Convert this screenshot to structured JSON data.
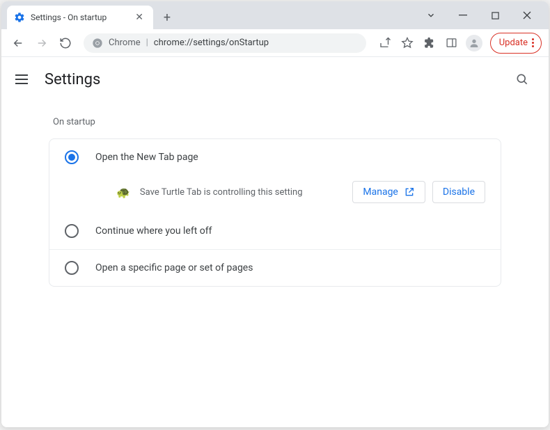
{
  "tab": {
    "title": "Settings - On startup"
  },
  "omnibox": {
    "prefix": "Chrome",
    "path": "chrome://settings/onStartup"
  },
  "update": {
    "label": "Update"
  },
  "page": {
    "title": "Settings"
  },
  "section": {
    "label": "On startup",
    "options": [
      {
        "label": "Open the New Tab page"
      },
      {
        "label": "Continue where you left off"
      },
      {
        "label": "Open a specific page or set of pages"
      }
    ],
    "controlled": {
      "text": "Save Turtle Tab is controlling this setting",
      "icon": "🐢",
      "manage": "Manage",
      "disable": "Disable"
    }
  }
}
